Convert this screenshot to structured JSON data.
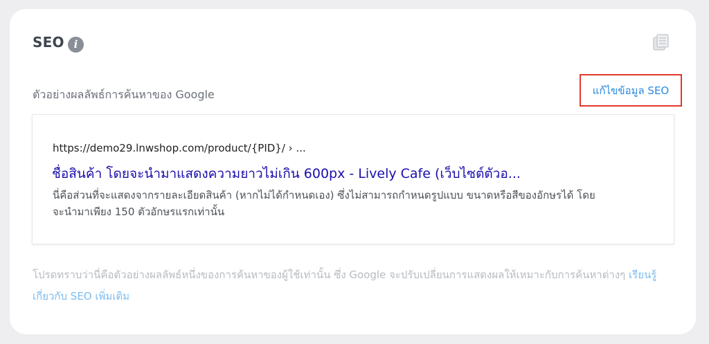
{
  "seo_card": {
    "title": "SEO",
    "info_icon": "info-icon",
    "info_glyph": "i",
    "copy_icon": "copy-icon"
  },
  "preview_section": {
    "label": "ตัวอย่างผลลัพธ์การค้นหาของ Google",
    "edit_link_label": "แก้ไขข้อมูล SEO",
    "edit_link_color": "#2a8be0",
    "highlight_border_color": "#e0372c"
  },
  "search_result": {
    "url": "https://demo29.lnwshop.com/product/{PID}/ › ...",
    "title": "ชื่อสินค้า โดยจะนำมาแสดงความยาวไม่เกิน 600px - Lively Cafe (เว็บไซต์ตัวอ...",
    "description": "นี่คือส่วนที่จะแสดงจากรายละเอียดสินค้า (หากไม่ได้กำหนดเอง) ซึ่งไม่สามารถกำหนดรูปแบบ ขนาดหรือสีของอักษรได้ โดยจะนำมาเพียง 150 ตัวอักษรแรกเท่านั้น",
    "title_color": "#1a0dab"
  },
  "footer": {
    "note": "โปรดทราบว่านี่คือตัวอย่างผลลัพธ์หนึ่งของการค้นหาของผู้ใช้เท่านั้น ซึ่ง Google จะปรับเปลี่ยนการแสดงผลให้เหมาะกับการค้นหาต่างๆ ",
    "learn_more_label": "เรียนรู้เกี่ยวกับ SEO เพิ่มเติม"
  }
}
